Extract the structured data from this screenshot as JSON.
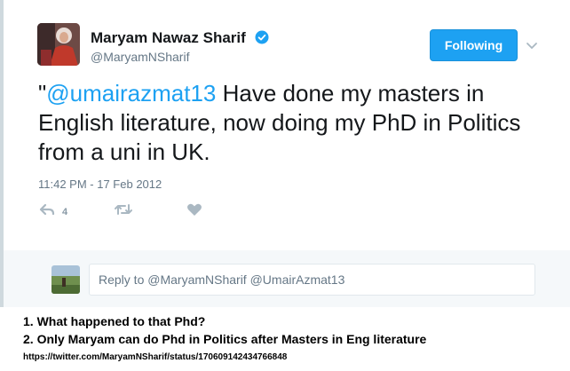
{
  "tweet": {
    "author_name": "Maryam Nawaz Sharif",
    "handle": "@MaryamNSharif",
    "follow_label": "Following",
    "text_prefix": "\"",
    "mention": "@umairazmat13",
    "text_body": " Have done my masters in English literature, now doing my PhD in Politics from a uni in UK.",
    "timestamp": "11:42 PM - 17 Feb 2012",
    "reply_count": "4"
  },
  "reply": {
    "placeholder": "Reply to @MaryamNSharif @UmairAzmat13"
  },
  "caption": {
    "line1": "1. What happened to that Phd?",
    "line2": "2. Only Maryam can do Phd in Politics after Masters in Eng literature",
    "url": "https://twitter.com/MaryamNSharif/status/170609142434766848"
  },
  "colors": {
    "brand_blue": "#1da1f2",
    "text_dark": "#14171a",
    "text_gray": "#657786",
    "verified": "#1da1f2"
  },
  "icons": [
    "verified-icon",
    "chevron-down-icon",
    "reply-icon",
    "retweet-icon",
    "like-icon"
  ]
}
